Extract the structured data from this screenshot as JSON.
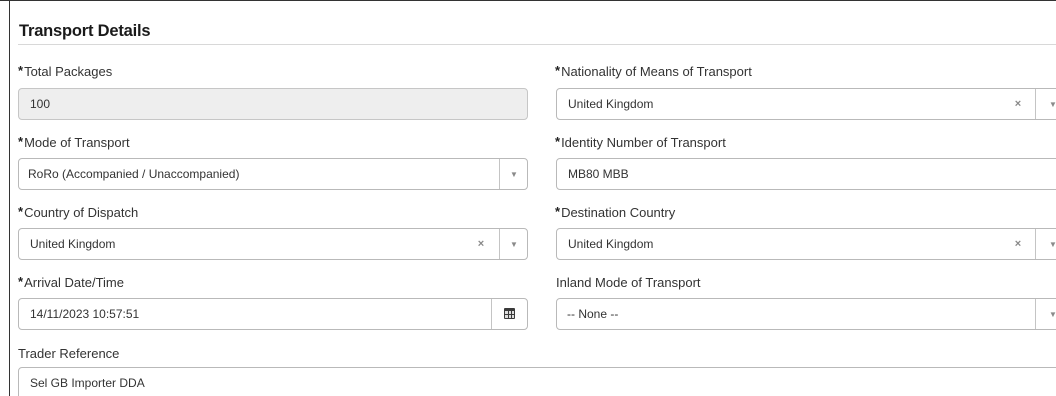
{
  "panel": {
    "title": "Transport Details"
  },
  "fields": {
    "total_packages": {
      "label": "Total Packages",
      "required": "*",
      "value": "100"
    },
    "nationality": {
      "label": "Nationality of Means of Transport",
      "required": "*",
      "value": "United Kingdom"
    },
    "mode": {
      "label": "Mode of Transport",
      "required": "*",
      "value": "RoRo (Accompanied / Unaccompanied)"
    },
    "identity": {
      "label": "Identity Number of Transport",
      "required": "*",
      "value": "MB80 MBB"
    },
    "dispatch": {
      "label": "Country of Dispatch",
      "required": "*",
      "value": "United Kingdom"
    },
    "destination": {
      "label": "Destination Country",
      "required": "*",
      "value": "United Kingdom"
    },
    "arrival": {
      "label": "Arrival Date/Time",
      "required": "*",
      "value": "14/11/2023 10:57:51"
    },
    "inland_mode": {
      "label": "Inland Mode of Transport",
      "value": "-- None --"
    },
    "trader_ref": {
      "label": "Trader Reference",
      "value": "Sel GB Importer DDA"
    }
  },
  "icons": {
    "clear": "×",
    "caret": "▼",
    "calendar": "calendar-icon"
  }
}
